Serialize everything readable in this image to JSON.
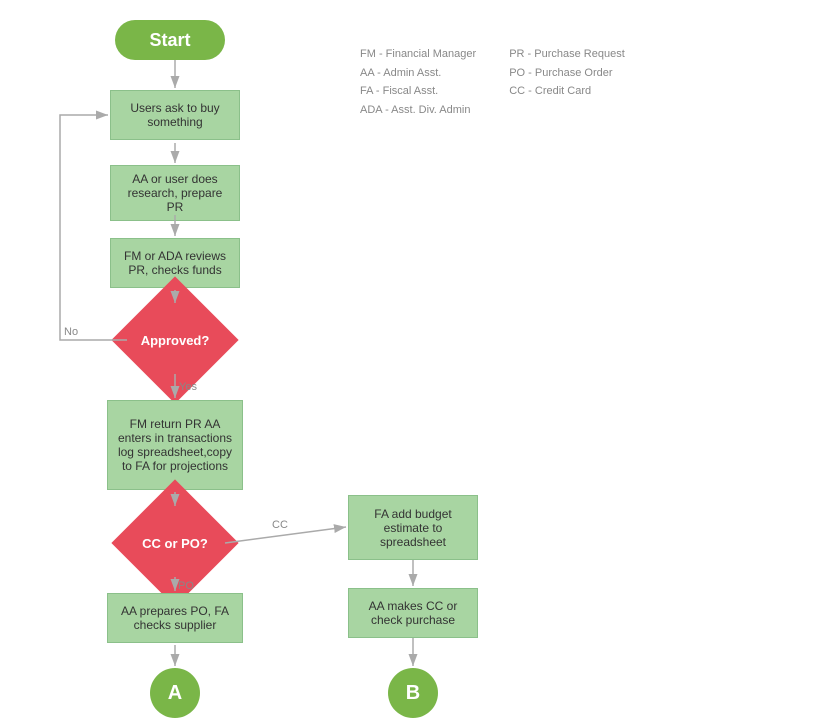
{
  "legend": {
    "col1": [
      "FM - Financial Manager",
      "AA - Admin Asst.",
      "FA - Fiscal Asst.",
      "ADA - Asst. Div. Admin"
    ],
    "col2": [
      "PR - Purchase Request",
      "PO - Purchase Order",
      "CC - Credit Card"
    ]
  },
  "nodes": {
    "start": "Start",
    "step1": "Users ask to buy something",
    "step2": "AA or user does research, prepare PR",
    "step3": "FM or ADA reviews PR, checks funds",
    "decision1": "Approved?",
    "step4": "FM return PR AA enters in transactions log spreadsheet,copy to FA for projections",
    "decision2": "CC or PO?",
    "step5": "FA add budget estimate to spreadsheet",
    "step6": "AA makes CC or check purchase",
    "step7": "AA prepares PO, FA checks supplier",
    "termA": "A",
    "termB": "B",
    "no_label": "No",
    "yes_label": "Yes",
    "cc_label": "CC",
    "po_label": "PO"
  }
}
